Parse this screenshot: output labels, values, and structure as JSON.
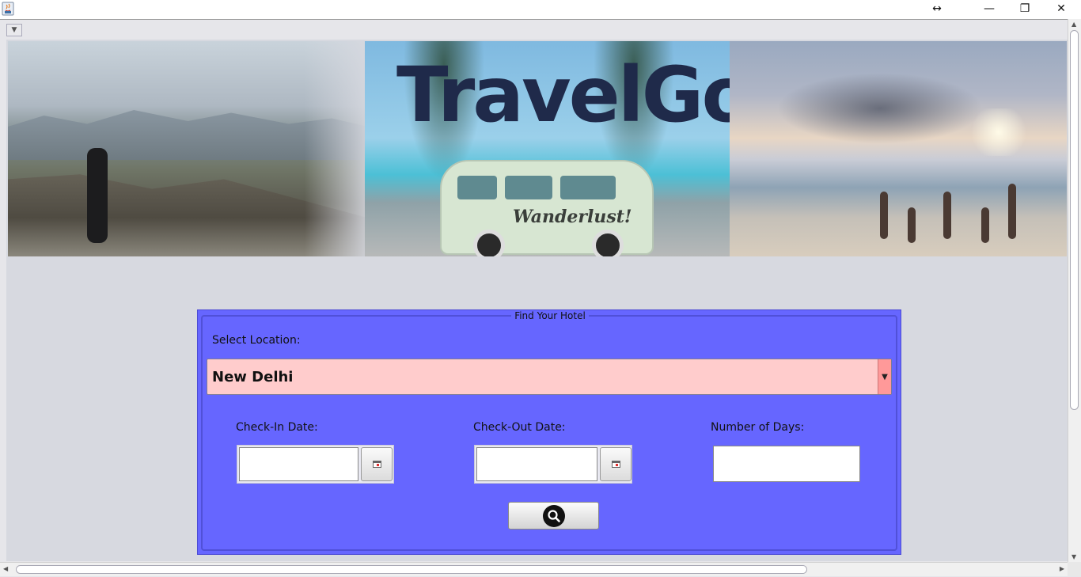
{
  "window": {
    "resize_glyph": "↔",
    "minimize_glyph": "—",
    "restore_glyph": "❐",
    "close_glyph": "✕"
  },
  "banner": {
    "logo_text": "TravelGo",
    "van_text": "Wanderlust!"
  },
  "panel": {
    "title": "Find Your Hotel",
    "location_label": "Select Location:",
    "location_value": "New Delhi",
    "checkin_label": "Check-In Date:",
    "checkout_label": "Check-Out Date:",
    "days_label": "Number of Days:",
    "checkin_value": "",
    "checkout_value": "",
    "days_value": ""
  },
  "icons": {
    "app": "java-icon",
    "calendar": "calendar-icon",
    "search": "magnifier-icon",
    "dropdown": "triangle-down-icon"
  },
  "colors": {
    "panel_bg": "#6666ff",
    "combo_bg": "#ffcccc",
    "content_bg": "#d7d9e0"
  }
}
